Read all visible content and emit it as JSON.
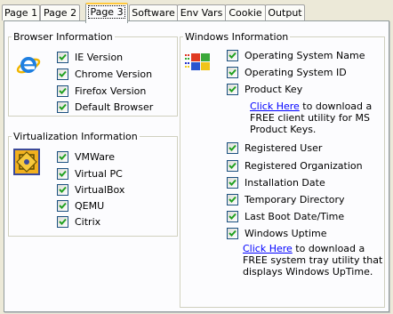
{
  "tabs": [
    "Page 1",
    "Page 2",
    "Page 3",
    "Software",
    "Env Vars",
    "Cookie",
    "Output"
  ],
  "active_tab": "Page 3",
  "browser": {
    "legend": "Browser Information",
    "items": [
      "IE Version",
      "Chrome Version",
      "Firefox Version",
      "Default Browser"
    ]
  },
  "virtualization": {
    "legend": "Virtualization Information",
    "items": [
      "VMWare",
      "Virtual PC",
      "VirtualBox",
      "QEMU",
      "Citrix"
    ]
  },
  "windows": {
    "legend": "Windows Information",
    "items_top": [
      "Operating System Name",
      "Operating System ID",
      "Product Key"
    ],
    "note1": {
      "link": "Click Here",
      "line1": " to download a",
      "line2": "FREE client utility for MS",
      "line3": "Product Keys."
    },
    "items_mid": [
      "Registered User",
      "Registered Organization",
      "Installation Date",
      "Temporary Directory",
      "Last Boot Date/Time",
      "Windows Uptime"
    ],
    "note2": {
      "link": "Click Here",
      "line1": " to download a",
      "line2": "FREE system tray utility that",
      "line3": "displays Windows UpTime."
    }
  },
  "colors": {
    "link": "#0000ff",
    "check": "#21a121",
    "active_tab_accent": "#ffc83c"
  },
  "icons": [
    "ie-logo-icon",
    "vmware-logo-icon",
    "windows-logo-icon",
    "checkmark-icon"
  ]
}
